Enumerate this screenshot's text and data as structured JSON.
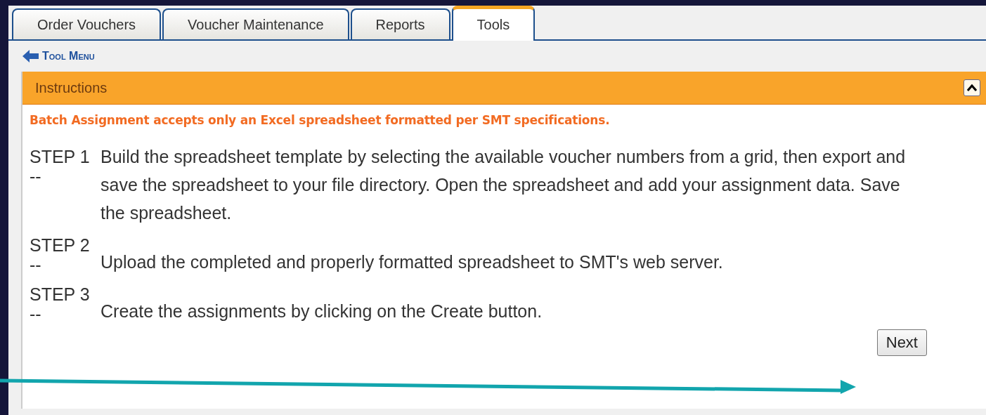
{
  "tabs": [
    {
      "label": "Order Vouchers",
      "selected": false
    },
    {
      "label": "Voucher Maintenance",
      "selected": false
    },
    {
      "label": "Reports",
      "selected": false
    },
    {
      "label": "Tools",
      "selected": true
    }
  ],
  "back_link": {
    "label": "Tool Menu"
  },
  "panel": {
    "title": "Instructions",
    "expanded": true,
    "notice": "Batch Assignment accepts only an Excel spreadsheet formatted per SMT specifications.",
    "steps": [
      {
        "label": "STEP 1",
        "marker": "--",
        "text": "Build the spreadsheet template by selecting the available voucher numbers from a grid, then export and save the spreadsheet to your file directory. Open the spreadsheet and add your assignment data. Save the spreadsheet."
      },
      {
        "label": "STEP 2",
        "marker": "--",
        "text": "Upload the completed and properly formatted spreadsheet to SMT's web server."
      },
      {
        "label": "STEP 3",
        "marker": "--",
        "text": "Create the assignments by clicking on the Create button."
      }
    ],
    "button": "Next"
  }
}
